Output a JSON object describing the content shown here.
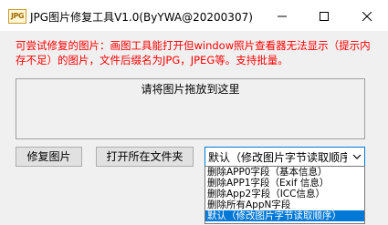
{
  "window": {
    "icon_text": "JPG",
    "title": "JPG图片修复工具V1.0(ByYWA@20200307)"
  },
  "hint": "可尝试修复的图片：画图工具能打开但window照片查看器无法显示（提示内存不足）的图片，文件后缀名为JPG，JPEG等。支持批量。",
  "dropzone": {
    "text": "请将图片拖放到这里"
  },
  "buttons": {
    "repair": "修复图片",
    "open_folder": "打开所在文件夹"
  },
  "mode_select": {
    "value": "默认（修改图片字节读取顺序",
    "options": [
      "删除APP0字段（基本信息）",
      "删除APP1字段（Exif 信息）",
      "删除App2字段（ICC信息）",
      "删除所有AppN字段",
      "默认（修改图片字节读取顺序）"
    ],
    "selected_index": 4
  },
  "colors": {
    "hint_red": "#ff0000",
    "highlight_blue": "#0078d7"
  }
}
